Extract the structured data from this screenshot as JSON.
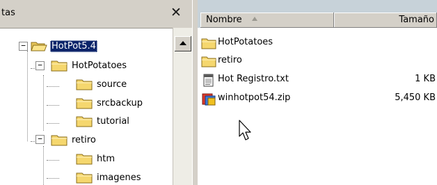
{
  "left_pane": {
    "title": "tas",
    "close_glyph": "✕",
    "tree": [
      {
        "label": "HotPot5.4",
        "expander": "−",
        "selected": true
      },
      {
        "label": "HotPotatoes",
        "expander": "−",
        "selected": false
      },
      {
        "label": "source",
        "selected": false
      },
      {
        "label": "srcbackup",
        "selected": false
      },
      {
        "label": "tutorial",
        "selected": false
      },
      {
        "label": "retiro",
        "expander": "−",
        "selected": false
      },
      {
        "label": "htm",
        "selected": false
      },
      {
        "label": "imagenes",
        "selected": false
      }
    ]
  },
  "list": {
    "columns": {
      "name": "Nombre",
      "size": "Tamaño"
    },
    "files": [
      {
        "name": "HotPotatoes",
        "size": "",
        "icon": "folder-icon"
      },
      {
        "name": "retiro",
        "size": "",
        "icon": "folder-icon"
      },
      {
        "name": "Hot Registro.txt",
        "size": "1 KB",
        "icon": "text-file-icon"
      },
      {
        "name": "winhotpot54.zip",
        "size": "5,450 KB",
        "icon": "zip-file-icon"
      }
    ]
  },
  "colors": {
    "selection": "#0a246a",
    "panel": "#d4d0c8",
    "folder": "#f5d76e"
  }
}
